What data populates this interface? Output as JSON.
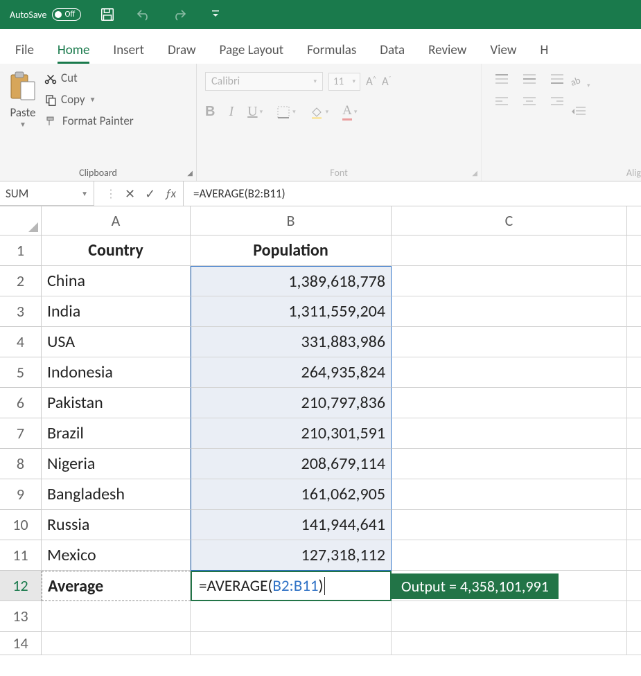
{
  "titlebar": {
    "autosave_label": "AutoSave",
    "autosave_state": "Off"
  },
  "tabs": [
    "File",
    "Home",
    "Insert",
    "Draw",
    "Page Layout",
    "Formulas",
    "Data",
    "Review",
    "View",
    "H"
  ],
  "active_tab_index": 1,
  "clipboard": {
    "paste": "Paste",
    "cut": "Cut",
    "copy": "Copy",
    "format_painter": "Format Painter",
    "group_label": "Clipboard"
  },
  "font": {
    "name": "Calibri",
    "size": "11",
    "group_label": "Font"
  },
  "alignment_group_label": "Alig",
  "name_box": "SUM",
  "formula_bar": "=AVERAGE(B2:B11)",
  "columns": [
    "A",
    "B",
    "C"
  ],
  "rows": [
    "1",
    "2",
    "3",
    "4",
    "5",
    "6",
    "7",
    "8",
    "9",
    "10",
    "11",
    "12",
    "13",
    "14"
  ],
  "headers": {
    "A": "Country",
    "B": "Population"
  },
  "data": [
    {
      "country": "China",
      "pop": "1,389,618,778"
    },
    {
      "country": "India",
      "pop": "1,311,559,204"
    },
    {
      "country": "USA",
      "pop": "331,883,986"
    },
    {
      "country": "Indonesia",
      "pop": "264,935,824"
    },
    {
      "country": "Pakistan",
      "pop": "210,797,836"
    },
    {
      "country": "Brazil",
      "pop": "210,301,591"
    },
    {
      "country": "Nigeria",
      "pop": "208,679,114"
    },
    {
      "country": "Bangladesh",
      "pop": "161,062,905"
    },
    {
      "country": "Russia",
      "pop": "141,944,641"
    },
    {
      "country": "Mexico",
      "pop": "127,318,112"
    }
  ],
  "average_row": {
    "label": "Average",
    "formula_pre": "=AVERAGE(",
    "formula_ref": "B2:B11",
    "formula_post": ")"
  },
  "output_tooltip": "Output = 4,358,101,991"
}
